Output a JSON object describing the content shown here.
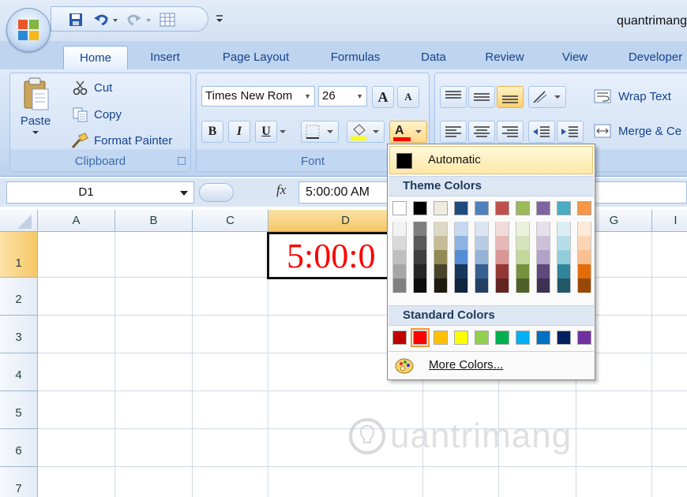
{
  "app_title": "quantrimang",
  "tabs": [
    "Home",
    "Insert",
    "Page Layout",
    "Formulas",
    "Data",
    "Review",
    "View",
    "Developer"
  ],
  "clipboard": {
    "paste_label": "Paste",
    "cut_label": "Cut",
    "copy_label": "Copy",
    "format_painter_label": "Format Painter",
    "group_label": "Clipboard"
  },
  "font": {
    "name_value": "Times New Rom",
    "size_value": "26",
    "bold_label": "B",
    "italic_label": "I",
    "underline_label": "U",
    "grow_label": "A",
    "shrink_label": "A",
    "font_color_label": "A",
    "group_label": "Font"
  },
  "alignment": {
    "wrap_text_label": "Wrap Text",
    "merge_label": "Merge & Ce",
    "group_label": "nt"
  },
  "formula_bar": {
    "name_box": "D1",
    "fx_label": "fx",
    "content": "5:00:00 AM"
  },
  "grid": {
    "columns": [
      "A",
      "B",
      "C",
      "D",
      "",
      "G",
      "I"
    ],
    "rows": [
      "1",
      "2",
      "3",
      "4",
      "5",
      "6",
      "7"
    ],
    "selected_cell": "D1",
    "cell_d1_text": "5:00:0"
  },
  "color_menu": {
    "automatic_label": "Automatic",
    "theme_colors_label": "Theme Colors",
    "standard_colors_label": "Standard Colors",
    "more_colors_label": "More Colors...",
    "theme_top_row": [
      "#ffffff",
      "#000000",
      "#eeece1",
      "#1f497d",
      "#4f81bd",
      "#c0504d",
      "#9bbb59",
      "#8064a2",
      "#4bacc6",
      "#f79646"
    ],
    "theme_shades": [
      [
        "#f2f2f2",
        "#d9d9d9",
        "#bfbfbf",
        "#a6a6a6",
        "#808080"
      ],
      [
        "#7f7f7f",
        "#595959",
        "#3f3f3f",
        "#262626",
        "#0d0d0d"
      ],
      [
        "#ddd9c3",
        "#c4bd97",
        "#938953",
        "#494429",
        "#1d1b10"
      ],
      [
        "#c6d9f0",
        "#8db3e2",
        "#548dd4",
        "#17365d",
        "#0f243e"
      ],
      [
        "#dbe5f1",
        "#b8cce4",
        "#95b3d7",
        "#366092",
        "#244061"
      ],
      [
        "#f2dcdb",
        "#e5b9b7",
        "#d99694",
        "#953734",
        "#632423"
      ],
      [
        "#ebf1dd",
        "#d7e3bc",
        "#c3d69b",
        "#76923c",
        "#4f6128"
      ],
      [
        "#e5e0ec",
        "#ccc1d9",
        "#b2a2c7",
        "#5f497a",
        "#3f3151"
      ],
      [
        "#dbeef3",
        "#b7dde8",
        "#92cddc",
        "#31859b",
        "#205867"
      ],
      [
        "#fdeada",
        "#fbd5b5",
        "#fac08f",
        "#e36c09",
        "#974806"
      ]
    ],
    "standard": [
      "#c00000",
      "#ff0000",
      "#ffc000",
      "#ffff00",
      "#92d050",
      "#00b050",
      "#00b0f0",
      "#0070c0",
      "#002060",
      "#7030a0"
    ],
    "selected_standard": "#ff0000"
  },
  "watermark_text": "uantrimang",
  "colors": {
    "cell_text": "#ff0000",
    "selection_header": "#f6c766"
  }
}
